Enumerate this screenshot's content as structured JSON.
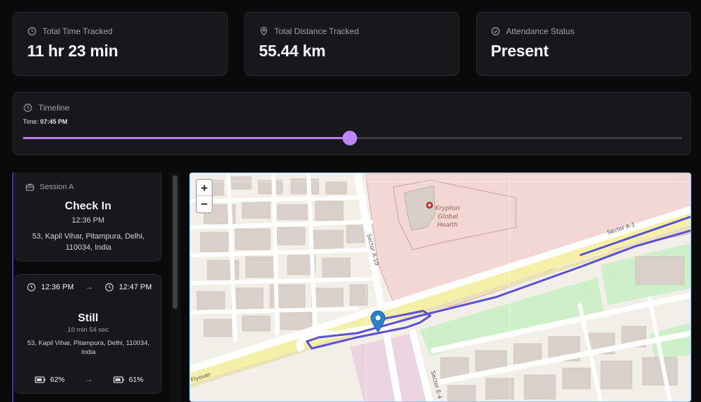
{
  "stats": [
    {
      "label": "Total Time Tracked",
      "value": "11 hr 23 min",
      "icon": "clock-icon"
    },
    {
      "label": "Total Distance Tracked",
      "value": "55.44 km",
      "icon": "map-pin-icon"
    },
    {
      "label": "Attendance Status",
      "value": "Present",
      "icon": "check-circle-icon"
    }
  ],
  "timeline": {
    "label": "Timeline",
    "time_prefix": "Time:",
    "time_value": "07:45 PM",
    "progress": 0.495
  },
  "sessions": {
    "session_a": {
      "label": "Session A",
      "title": "Check In",
      "time": "12:36 PM",
      "address": "53, Kapil Vihar, Pitampura, Delhi, 110034, India"
    },
    "still": {
      "start_time": "12:36 PM",
      "end_time": "12:47 PM",
      "arrow": "→",
      "title": "Still",
      "duration": "10 min 54 sec",
      "address": "53, Kapil Vihar, Pitampura, Delhi, 110034, India",
      "battery_start": "62%",
      "battery_end": "61%"
    }
  },
  "map": {
    "zoom_in": "+",
    "zoom_out": "−",
    "hospital_name": "Krypton Global Health",
    "hospital_lines": [
      "Krypton",
      "Global",
      "Health"
    ],
    "road_labels": [
      "Sector A-1",
      "Sector A-10",
      "Sector E-4",
      "Flyover"
    ],
    "route_color": "#5b4fd6",
    "marker_color": "#2b82cb"
  },
  "colors": {
    "accent": "#c084fc",
    "background": "#0a0a0b",
    "card": "#18181b"
  }
}
